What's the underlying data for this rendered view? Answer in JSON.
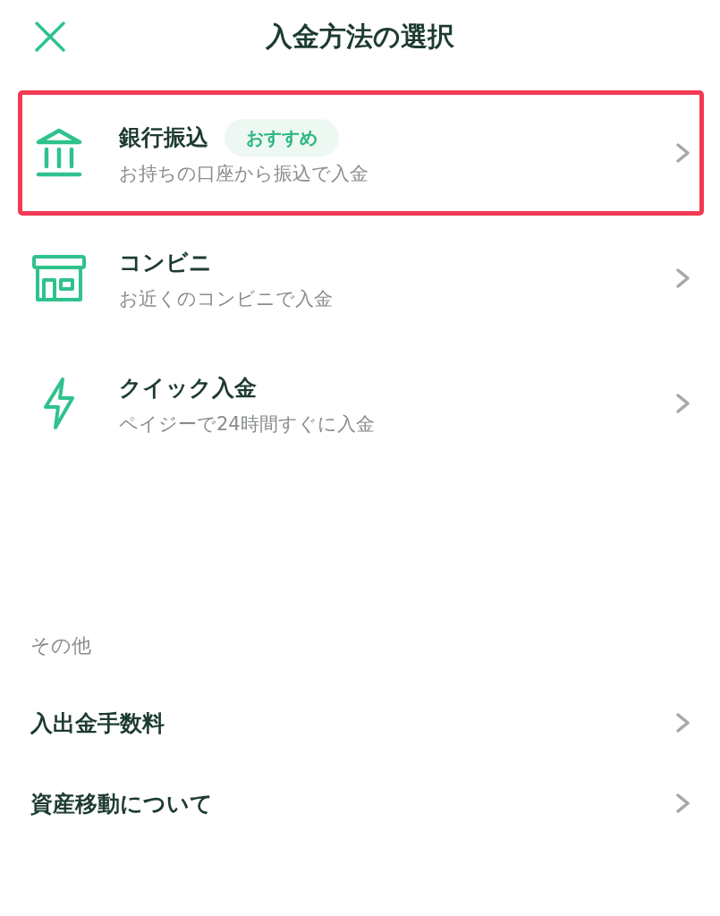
{
  "header": {
    "title": "入金方法の選択"
  },
  "methods": [
    {
      "kind": "bank",
      "title": "銀行振込",
      "badge": "おすすめ",
      "description": "お持ちの口座から振込で入金",
      "highlighted": true
    },
    {
      "kind": "store",
      "title": "コンビニ",
      "description": "お近くのコンビニで入金",
      "highlighted": false
    },
    {
      "kind": "instant",
      "title": "クイック入金",
      "description": "ペイジーで24時間すぐに入金",
      "highlighted": false
    }
  ],
  "other": {
    "heading": "その他",
    "items": [
      {
        "label": "入出金手数料"
      },
      {
        "label": "資産移動について"
      }
    ]
  }
}
